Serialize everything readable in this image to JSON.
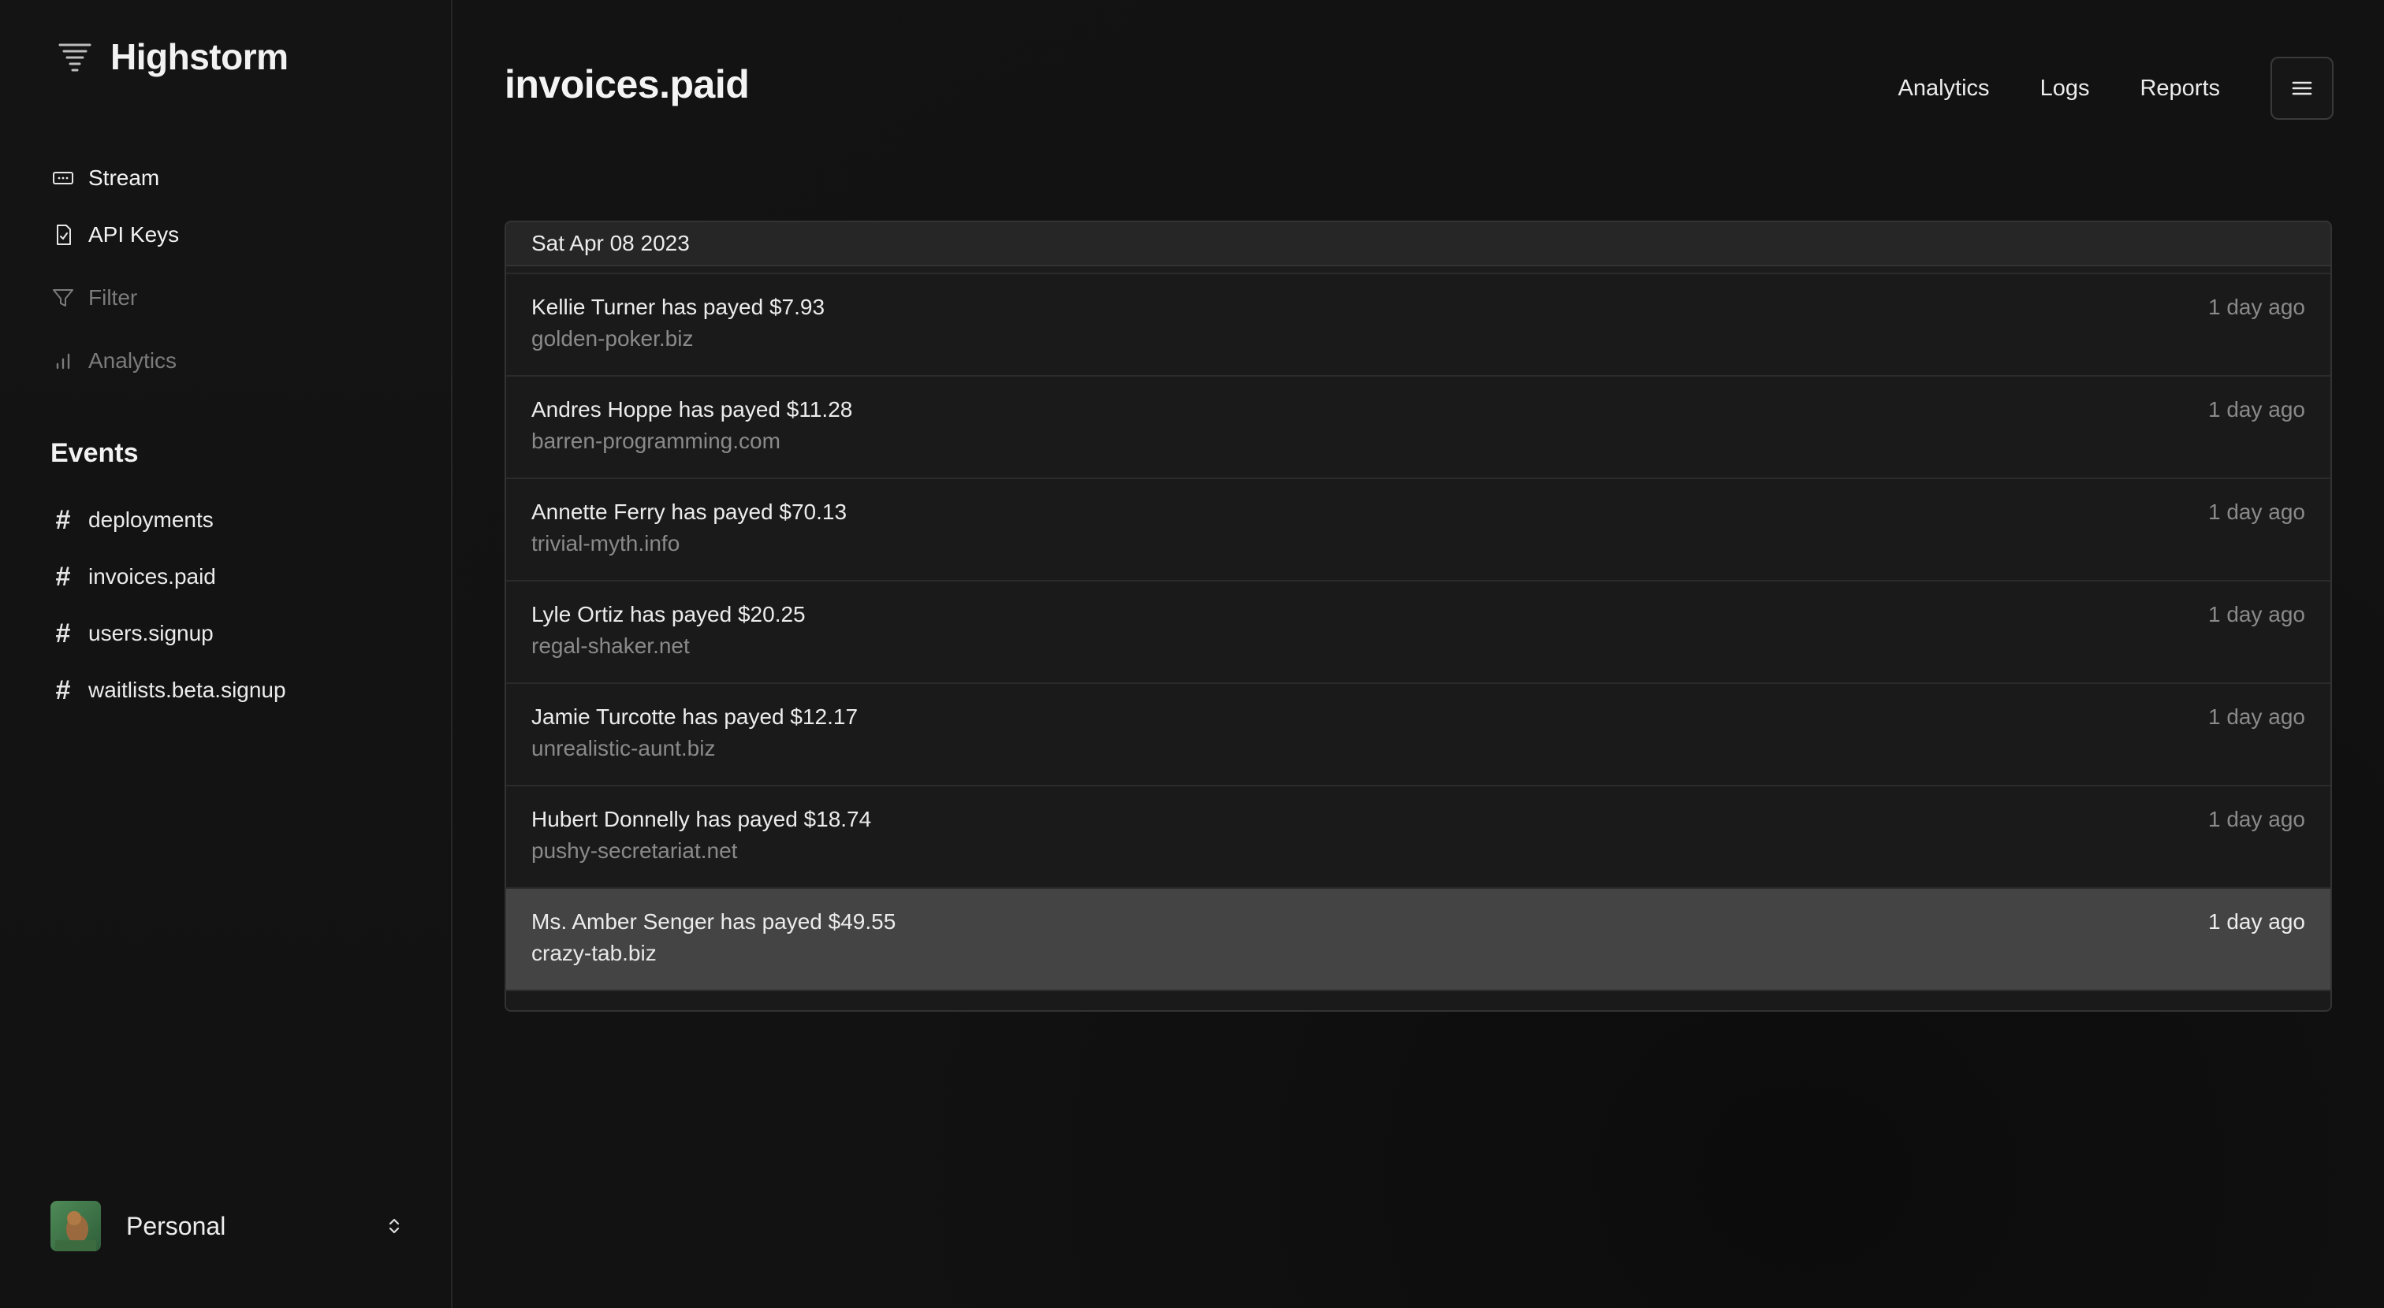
{
  "app": {
    "name": "Highstorm"
  },
  "sidebar": {
    "nav": [
      {
        "label": "Stream",
        "icon": "stream-icon",
        "state": "active"
      },
      {
        "label": "API Keys",
        "icon": "api-keys-icon",
        "state": "active"
      },
      {
        "label": "Filter",
        "icon": "filter-icon",
        "state": "dim"
      },
      {
        "label": "Analytics",
        "icon": "analytics-icon",
        "state": "dim"
      }
    ],
    "events_title": "Events",
    "events": [
      {
        "label": "deployments"
      },
      {
        "label": "invoices.paid"
      },
      {
        "label": "users.signup"
      },
      {
        "label": "waitlists.beta.signup"
      }
    ],
    "workspace": {
      "name": "Personal"
    }
  },
  "header": {
    "title": "invoices.paid",
    "links": [
      "Analytics",
      "Logs",
      "Reports"
    ]
  },
  "feed": {
    "date": "Sat Apr 08 2023",
    "items": [
      {
        "title": "Kellie Turner has payed $7.93",
        "domain": "golden-poker.biz",
        "time": "1 day ago"
      },
      {
        "title": "Andres Hoppe has payed $11.28",
        "domain": "barren-programming.com",
        "time": "1 day ago"
      },
      {
        "title": "Annette Ferry has payed $70.13",
        "domain": "trivial-myth.info",
        "time": "1 day ago"
      },
      {
        "title": "Lyle Ortiz has payed $20.25",
        "domain": "regal-shaker.net",
        "time": "1 day ago"
      },
      {
        "title": "Jamie Turcotte has payed $12.17",
        "domain": "unrealistic-aunt.biz",
        "time": "1 day ago"
      },
      {
        "title": "Hubert Donnelly has payed $18.74",
        "domain": "pushy-secretariat.net",
        "time": "1 day ago"
      },
      {
        "title": "Ms. Amber Senger has payed $49.55",
        "domain": "crazy-tab.biz",
        "time": "1 day ago",
        "highlighted": true
      }
    ]
  },
  "colors": {
    "background": "#111111",
    "panel": "#1a1a1a",
    "highlight_row": "#444444",
    "muted_text": "#8a8a8a"
  }
}
